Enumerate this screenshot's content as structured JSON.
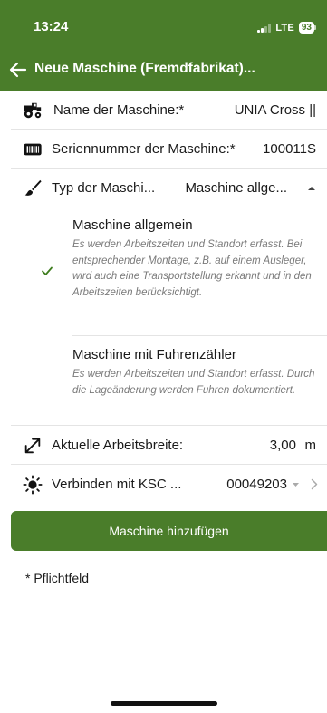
{
  "status_bar": {
    "time": "13:24",
    "network": "LTE",
    "battery": "93"
  },
  "header": {
    "title": "Neue Maschine (Fremdfabrikat)..."
  },
  "fields": [
    {
      "label": "Name der Maschine:*",
      "value": "UNIA Cross ||",
      "icon": "tractor-icon"
    },
    {
      "label": "Seriennummer der Maschine:*",
      "value": "100011S",
      "icon": "serial-number-icon"
    },
    {
      "label": "Typ der Maschi...",
      "value": "Maschine allge...",
      "icon": "brush-icon"
    }
  ],
  "type_options": [
    {
      "title": "Maschine allgemein",
      "description": "Es werden Arbeitszeiten und Standort erfasst. Bei entsprechender Montage, z.B. auf einem Ausleger, wird auch eine Transportstellung erkannt und in den Arbeitszeiten berücksichtigt.",
      "selected": true
    },
    {
      "title": "Maschine mit Fuhrenzähler",
      "description": "Es werden Arbeitszeiten und Standort erfasst. Durch die Lageänderung werden Fuhren dokumentiert.",
      "selected": false
    }
  ],
  "width_field": {
    "label": "Aktuelle Arbeitsbreite:",
    "value": "3,00",
    "unit": "m"
  },
  "connect_field": {
    "label": "Verbinden mit KSC ...",
    "value": "00049203"
  },
  "submit_button": {
    "label": "Maschine hinzufügen"
  },
  "footer_note": "* Pflichtfeld",
  "colors": {
    "brand_green": "#4a7d2a",
    "check_green": "#3e7d1e",
    "description_gray": "#7a7a7a"
  }
}
